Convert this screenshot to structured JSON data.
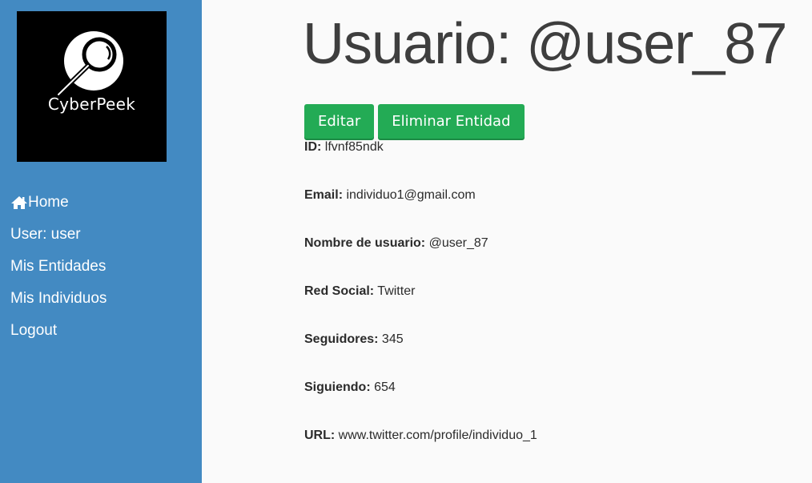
{
  "logo": {
    "text": "CyberPeek"
  },
  "nav": {
    "home": "Home",
    "user": "User: user",
    "entidades": "Mis Entidades",
    "individuos": "Mis Individuos",
    "logout": "Logout"
  },
  "page": {
    "title": "Usuario: @user_87"
  },
  "actions": {
    "edit": "Editar",
    "delete": "Eliminar Entidad"
  },
  "fields": [
    {
      "label": "ID:",
      "value": "lfvnf85ndk"
    },
    {
      "label": "Email:",
      "value": "individuo1@gmail.com"
    },
    {
      "label": "Nombre de usuario:",
      "value": "@user_87"
    },
    {
      "label": "Red Social:",
      "value": "Twitter"
    },
    {
      "label": "Seguidores:",
      "value": "345"
    },
    {
      "label": "Siguiendo:",
      "value": "654"
    },
    {
      "label": "URL:",
      "value": "www.twitter.com/profile/individuo_1"
    }
  ],
  "colors": {
    "sidebar": "#438ac2",
    "button": "#23ab55",
    "title": "#3e3e3e"
  },
  "icons": {
    "home": "home-icon",
    "logo": "magnifier-icon"
  }
}
